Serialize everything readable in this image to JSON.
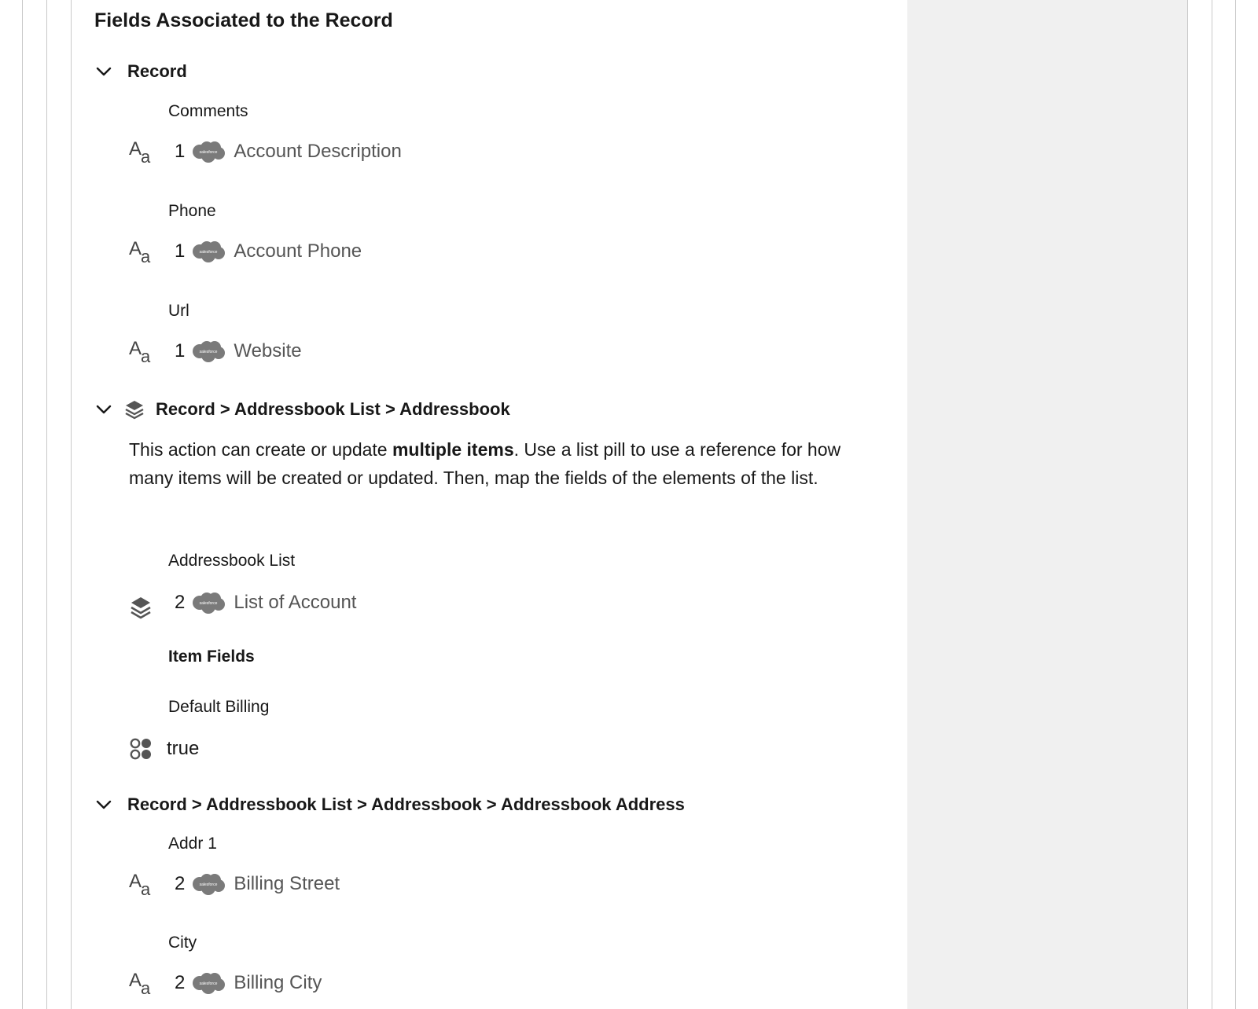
{
  "panel": {
    "title": "Fields Associated to the Record"
  },
  "sections": [
    {
      "title": "Record",
      "fields": [
        {
          "label": "Comments",
          "step": "1",
          "value": "Account Description",
          "type_icon": "text-type-icon"
        },
        {
          "label": "Phone",
          "step": "1",
          "value": "Account Phone",
          "type_icon": "text-type-icon"
        },
        {
          "label": "Url",
          "step": "1",
          "value": "Website",
          "type_icon": "text-type-icon"
        }
      ]
    },
    {
      "title": "Record > Addressbook List > Addressbook",
      "info": {
        "before": "This action can create or update ",
        "bold": "multiple items",
        "after": ". Use a list pill to use a reference for how many items will be created or updated. Then, map the fields of the elements of the list."
      },
      "list_field": {
        "label": "Addressbook List",
        "step": "2",
        "value": "List of Account",
        "type_icon": "layers-icon"
      },
      "item_fields_heading": "Item Fields",
      "item_fields": [
        {
          "label": "Default Billing",
          "value": "true",
          "type_icon": "boolean-icon"
        }
      ]
    },
    {
      "title": "Record > Addressbook List > Addressbook > Addressbook Address",
      "fields": [
        {
          "label": "Addr 1",
          "step": "2",
          "value": "Billing Street",
          "type_icon": "text-type-icon"
        },
        {
          "label": "City",
          "step": "2",
          "value": "Billing City",
          "type_icon": "text-type-icon"
        }
      ]
    }
  ],
  "logo_text": "salesforce",
  "colors": {
    "side_panel": "#f0f0f0",
    "border": "#c9c9c9",
    "logo": "#7a7a7a",
    "value_text": "#555555"
  }
}
